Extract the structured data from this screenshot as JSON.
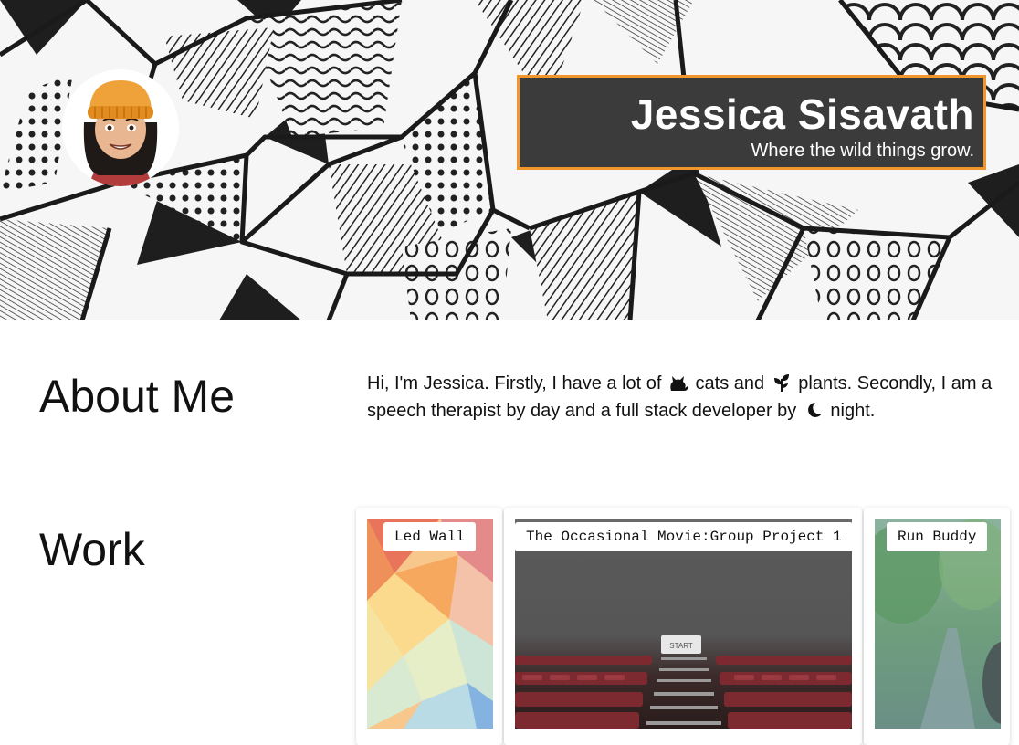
{
  "header": {
    "name": "Jessica Sisavath",
    "tagline": "Where the wild things grow.",
    "colors": {
      "box_bg": "#3b3b3b",
      "box_border": "#f0962d"
    }
  },
  "about": {
    "heading": "About Me",
    "text_1": "Hi, I'm Jessica. Firstly, I have a lot of",
    "icon_1": "cat-icon",
    "text_2": "cats and",
    "icon_2": "seedling-icon",
    "text_3": "plants. Secondly, I am a speech therapist by day and a full stack developer by",
    "icon_3": "moon-icon",
    "text_4": "night."
  },
  "work": {
    "heading": "Work",
    "projects": [
      {
        "label": "Led Wall"
      },
      {
        "label": "The Occasional Movie:Group Project 1",
        "button": "START"
      },
      {
        "label": "Run Buddy"
      }
    ]
  }
}
